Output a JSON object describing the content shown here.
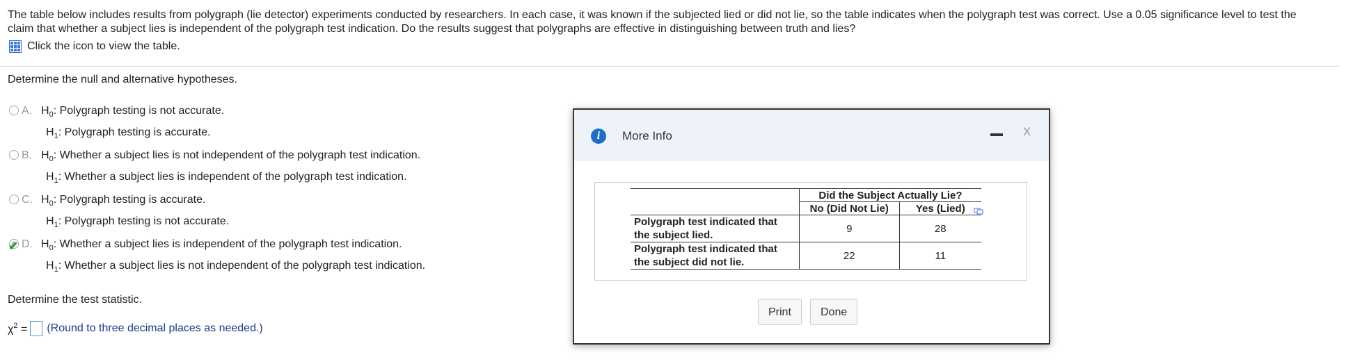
{
  "question": {
    "intro": "The table below includes results from polygraph (lie detector) experiments conducted by researchers. In each case, it was known if the subjected lied or did not lie, so the table indicates when the polygraph test was correct. Use a 0.05 significance level to test the claim that whether a subject lies is independent of the polygraph test indication. Do the results suggest that polygraphs are effective in distinguishing between truth and lies?",
    "click_text": "Click the icon to view the table.",
    "part1_prompt": "Determine the null and alternative hypotheses.",
    "options": [
      {
        "letter": "A.",
        "h0_label": "H",
        "h0_sub": "0",
        "h0": ": Polygraph testing is not accurate.",
        "h1_label": "H",
        "h1_sub": "1",
        "h1": ": Polygraph testing is accurate."
      },
      {
        "letter": "B.",
        "h0_label": "H",
        "h0_sub": "0",
        "h0": ": Whether a subject lies is not independent of the polygraph test indication.",
        "h1_label": "H",
        "h1_sub": "1",
        "h1": ": Whether a subject lies is independent of the polygraph test indication."
      },
      {
        "letter": "C.",
        "h0_label": "H",
        "h0_sub": "0",
        "h0": ": Polygraph testing is accurate.",
        "h1_label": "H",
        "h1_sub": "1",
        "h1": ": Polygraph testing is not accurate."
      },
      {
        "letter": "D.",
        "h0_label": "H",
        "h0_sub": "0",
        "h0": ": Whether a subject lies is independent of the polygraph test indication.",
        "h1_label": "H",
        "h1_sub": "1",
        "h1": ": Whether a subject lies is not independent of the polygraph test indication."
      }
    ],
    "part2_prompt": "Determine the test statistic.",
    "chi_symbol": "χ",
    "chi_exp": "2",
    "equals": "=",
    "round_hint": "(Round to three decimal places as needed.)"
  },
  "modal": {
    "title": "More Info",
    "info_glyph": "i",
    "close_glyph": "X",
    "table": {
      "group_header": "Did the Subject Actually Lie?",
      "col1": "No (Did Not Lie)",
      "col2": "Yes (Lied)",
      "rows": [
        {
          "label": "Polygraph test indicated that the subject lied.",
          "no": "9",
          "yes": "28"
        },
        {
          "label": "Polygraph test indicated that the subject did not lie.",
          "no": "22",
          "yes": "11"
        }
      ]
    },
    "print_label": "Print",
    "done_label": "Done"
  },
  "colors": {
    "accent": "#1f6fc6",
    "check": "#2a9a2a",
    "hint": "#1a3a8c"
  }
}
